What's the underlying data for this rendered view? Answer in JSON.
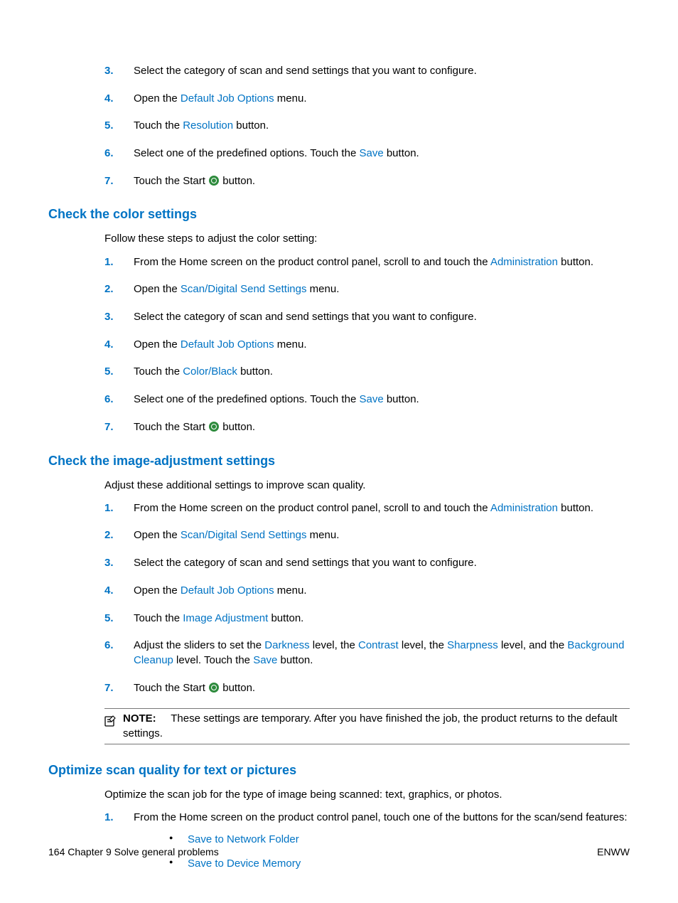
{
  "top_steps": [
    {
      "n": "3.",
      "text": "Select the category of scan and send settings that you want to configure."
    },
    {
      "n": "4.",
      "pre": "Open the ",
      "kw": "Default Job Options",
      "post": " menu."
    },
    {
      "n": "5.",
      "pre": "Touch the ",
      "kw": "Resolution",
      "post": " button."
    },
    {
      "n": "6.",
      "pre": "Select one of the predefined options. Touch the ",
      "kw": "Save",
      "post": " button."
    },
    {
      "n": "7.",
      "start": true,
      "pre": "Touch the Start ",
      "post": " button."
    }
  ],
  "s1": {
    "heading": "Check the color settings",
    "intro": "Follow these steps to adjust the color setting:",
    "steps": [
      {
        "n": "1.",
        "pre": "From the Home screen on the product control panel, scroll to and touch the ",
        "kw": "Administration",
        "post": " button."
      },
      {
        "n": "2.",
        "pre": "Open the ",
        "kw": "Scan/Digital Send Settings",
        "post": " menu."
      },
      {
        "n": "3.",
        "text": "Select the category of scan and send settings that you want to configure."
      },
      {
        "n": "4.",
        "pre": "Open the ",
        "kw": "Default Job Options",
        "post": " menu."
      },
      {
        "n": "5.",
        "pre": "Touch the ",
        "kw": "Color/Black",
        "post": " button."
      },
      {
        "n": "6.",
        "pre": "Select one of the predefined options. Touch the ",
        "kw": "Save",
        "post": " button."
      },
      {
        "n": "7.",
        "start": true,
        "pre": "Touch the Start ",
        "post": " button."
      }
    ]
  },
  "s2": {
    "heading": "Check the image-adjustment settings",
    "intro": "Adjust these additional settings to improve scan quality.",
    "steps": [
      {
        "n": "1.",
        "pre": "From the Home screen on the product control panel, scroll to and touch the ",
        "kw": "Administration",
        "post": " button."
      },
      {
        "n": "2.",
        "pre": "Open the ",
        "kw": "Scan/Digital Send Settings",
        "post": " menu."
      },
      {
        "n": "3.",
        "text": "Select the category of scan and send settings that you want to configure."
      },
      {
        "n": "4.",
        "pre": "Open the ",
        "kw": "Default Job Options",
        "post": " menu."
      },
      {
        "n": "5.",
        "pre": "Touch the ",
        "kw": "Image Adjustment",
        "post": " button."
      },
      {
        "n": "6.",
        "adjusters": true,
        "t0": "Adjust the sliders to set the ",
        "k0": "Darkness",
        "t1": " level, the ",
        "k1": "Contrast",
        "t2": " level, the ",
        "k2": "Sharpness",
        "t3": " level, and the ",
        "k3": "Background Cleanup",
        "t4": " level. Touch the ",
        "k4": "Save",
        "t5": " button."
      },
      {
        "n": "7.",
        "start": true,
        "pre": "Touch the Start ",
        "post": " button."
      }
    ],
    "note_label": "NOTE:",
    "note_body": "These settings are temporary. After you have finished the job, the product returns to the default settings."
  },
  "s3": {
    "heading": "Optimize scan quality for text or pictures",
    "intro": "Optimize the scan job for the type of image being scanned: text, graphics, or photos.",
    "steps": [
      {
        "n": "1.",
        "text": "From the Home screen on the product control panel, touch one of the buttons for the scan/send features:",
        "bullets": [
          "Save to Network Folder",
          "Save to Device Memory"
        ]
      }
    ]
  },
  "footer": {
    "left": "164   Chapter 9   Solve general problems",
    "right": "ENWW"
  }
}
